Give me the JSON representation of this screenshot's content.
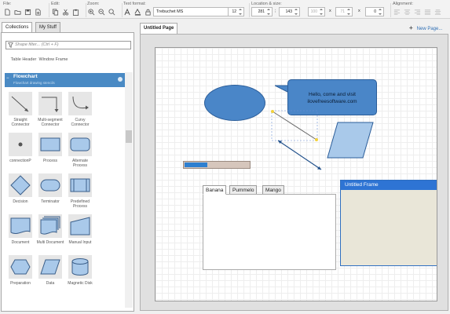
{
  "toolbar": {
    "file_label": "File:",
    "edit_label": "Edit:",
    "zoom_label": "Zoom:",
    "text_format_label": "Text format:",
    "location_label": "Location & size:",
    "alignment_label": "Alignment:",
    "font_name": "Trebuchet MS",
    "font_size": "12",
    "x": "281",
    "y": "143",
    "w": "100",
    "h": "71",
    "angle": "0",
    "x_sep": ";",
    "times1": "x",
    "times2": "x",
    "angle_label": "≤"
  },
  "left_panel": {
    "tabs": [
      "Collections",
      "My Stuff"
    ],
    "filter_placeholder": "Shape filter... (Ctrl + F)",
    "prev_items": [
      "Table Header",
      "Window Frame"
    ],
    "section_title": "Flowchart",
    "section_subtitle": "Flowchart drawing stencils",
    "stencils": [
      {
        "label": "Straight Connector",
        "icon": "straight-connector"
      },
      {
        "label": "Multi-segment Connector",
        "icon": "multi-segment-connector"
      },
      {
        "label": "Curvy Connector",
        "icon": "curvy-connector"
      },
      {
        "label": "connectionP",
        "icon": "connection-point"
      },
      {
        "label": "Process",
        "icon": "process"
      },
      {
        "label": "Alternate Process",
        "icon": "alternate-process"
      },
      {
        "label": "Decision",
        "icon": "decision"
      },
      {
        "label": "Terminator",
        "icon": "terminator"
      },
      {
        "label": "Predefined Process",
        "icon": "predefined-process"
      },
      {
        "label": "Document",
        "icon": "document"
      },
      {
        "label": "Multi Document",
        "icon": "multi-document"
      },
      {
        "label": "Manual Input",
        "icon": "manual-input"
      },
      {
        "label": "Preparation",
        "icon": "preparation"
      },
      {
        "label": "Data",
        "icon": "data"
      },
      {
        "label": "Magnetic Disk",
        "icon": "magnetic-disk"
      }
    ]
  },
  "document": {
    "tab_title": "Untitled Page",
    "new_page_label": "New Page...",
    "bubble_text_line1": "Hello, come and visit",
    "bubble_text_line2": "ilovefreesoftware.com",
    "progress_value": 0.34,
    "tabs": [
      "Banana",
      "Pummelo",
      "Mango"
    ],
    "frame_title": "Untitled Frame"
  },
  "colors": {
    "shape_fill": "#4a86c8",
    "accent": "#2e74d4",
    "stencil_fill": "#a9c9ea"
  }
}
